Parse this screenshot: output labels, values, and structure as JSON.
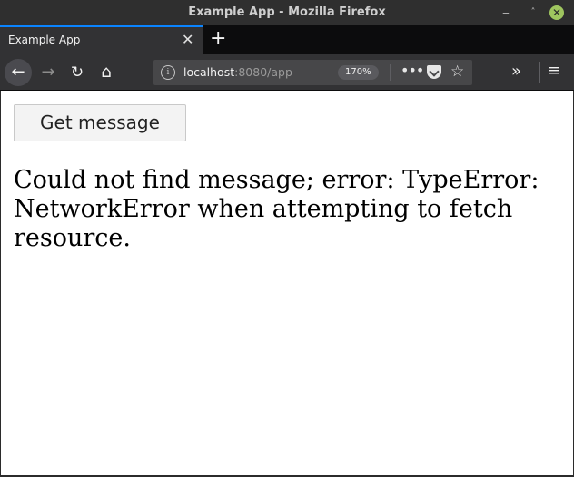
{
  "window": {
    "title": "Example App - Mozilla Firefox"
  },
  "window_controls": {
    "minimize": "‒",
    "maximize": "˄",
    "close": "✕"
  },
  "tabs": [
    {
      "label": "Example App",
      "close": "✕"
    }
  ],
  "newtab_label": "+",
  "nav": {
    "back_icon": "←",
    "forward_icon": "→",
    "reload_icon": "↻",
    "home_icon": "⌂",
    "overflow_icon": "»",
    "menu_icon": "≡"
  },
  "urlbar": {
    "host": "localhost",
    "path": ":8080/app",
    "zoom": "170%",
    "more_icon": "•••",
    "star_icon": "☆"
  },
  "page": {
    "button_label": "Get message",
    "message": "Could not find message; error: TypeError: NetworkError when attempting to fetch resource."
  },
  "colors": {
    "accent": "#0a84ff",
    "titlebar": "#2f2f2f",
    "toolbar": "#323234",
    "close_button": "#9fc55f"
  }
}
